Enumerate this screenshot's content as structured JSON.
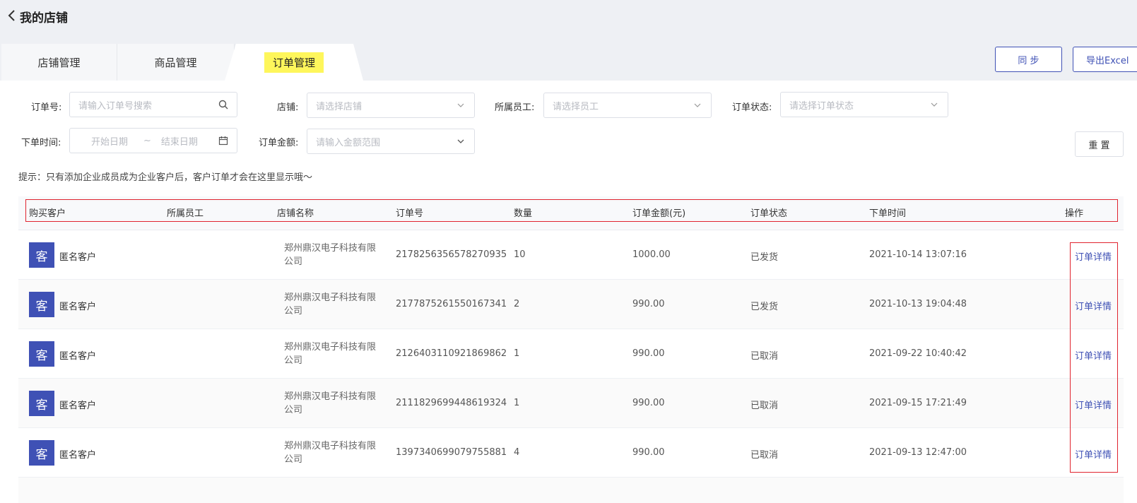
{
  "header": {
    "title": "我的店铺"
  },
  "tabs": [
    {
      "label": "店铺管理"
    },
    {
      "label": "商品管理"
    },
    {
      "label": "订单管理"
    }
  ],
  "actions": {
    "sync": "同 步",
    "export": "导出Excel"
  },
  "filters": {
    "order_no": {
      "label": "订单号:",
      "placeholder": "请输入订单号搜索"
    },
    "shop": {
      "label": "店铺:",
      "placeholder": "请选择店铺"
    },
    "staff": {
      "label": "所属员工:",
      "placeholder": "请选择员工"
    },
    "status": {
      "label": "订单状态:",
      "placeholder": "请选择订单状态"
    },
    "order_time": {
      "label": "下单时间:",
      "start": "开始日期",
      "sep": "~",
      "end": "结束日期"
    },
    "amount": {
      "label": "订单金额:",
      "placeholder": "请输入金额范围"
    },
    "reset": "重 置"
  },
  "hint": "提示：只有添加企业成员成为企业客户后，客户订单才会在这里显示哦～",
  "table": {
    "columns": [
      "购买客户",
      "所属员工",
      "店铺名称",
      "订单号",
      "数量",
      "订单金额(元)",
      "订单状态",
      "下单时间",
      "操作"
    ],
    "rows": [
      {
        "avatar": "客",
        "customer": "匿名客户",
        "staff": "",
        "shop_line1": "郑州鼎汉电子科技有限",
        "shop_line2": "公司",
        "order_no": "2178256356578270935",
        "qty": "10",
        "amount": "1000.00",
        "status": "已发货",
        "time": "2021-10-14 13:07:16",
        "action": "订单详情"
      },
      {
        "avatar": "客",
        "customer": "匿名客户",
        "staff": "",
        "shop_line1": "郑州鼎汉电子科技有限",
        "shop_line2": "公司",
        "order_no": "2177875261550167341",
        "qty": "2",
        "amount": "990.00",
        "status": "已发货",
        "time": "2021-10-13 19:04:48",
        "action": "订单详情"
      },
      {
        "avatar": "客",
        "customer": "匿名客户",
        "staff": "",
        "shop_line1": "郑州鼎汉电子科技有限",
        "shop_line2": "公司",
        "order_no": "2126403110921869862",
        "qty": "1",
        "amount": "990.00",
        "status": "已取消",
        "time": "2021-09-22 10:40:42",
        "action": "订单详情"
      },
      {
        "avatar": "客",
        "customer": "匿名客户",
        "staff": "",
        "shop_line1": "郑州鼎汉电子科技有限",
        "shop_line2": "公司",
        "order_no": "2111829699448619324",
        "qty": "1",
        "amount": "990.00",
        "status": "已取消",
        "time": "2021-09-15 17:21:49",
        "action": "订单详情"
      },
      {
        "avatar": "客",
        "customer": "匿名客户",
        "staff": "",
        "shop_line1": "郑州鼎汉电子科技有限",
        "shop_line2": "公司",
        "order_no": "1397340699079755881",
        "qty": "4",
        "amount": "990.00",
        "status": "已取消",
        "time": "2021-09-13 12:47:00",
        "action": "订单详情"
      }
    ]
  },
  "colors": {
    "accent": "#3f51b5",
    "highlight": "#fef65b",
    "annotation_red": "#e0242f"
  }
}
